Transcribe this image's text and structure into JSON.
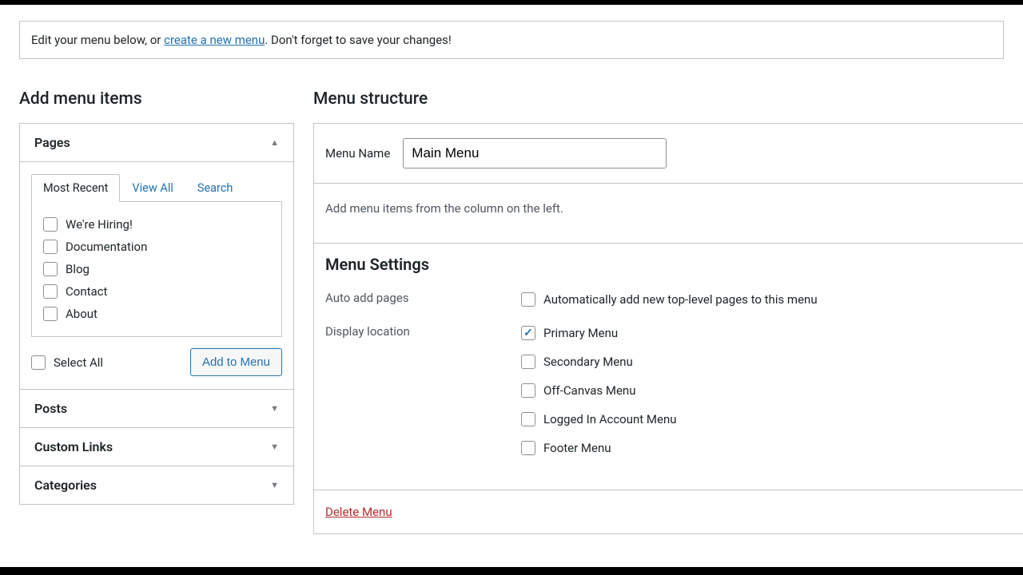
{
  "notice": {
    "prefix": "Edit your menu below, or ",
    "link": "create a new menu",
    "suffix": ". Don't forget to save your changes!"
  },
  "left": {
    "title": "Add menu items",
    "sections": {
      "pages": "Pages",
      "posts": "Posts",
      "custom_links": "Custom Links",
      "categories": "Categories"
    },
    "tabs": {
      "recent": "Most Recent",
      "view_all": "View All",
      "search": "Search"
    },
    "pages_list": [
      "We're Hiring!",
      "Documentation",
      "Blog",
      "Contact",
      "About"
    ],
    "select_all": "Select All",
    "add_btn": "Add to Menu"
  },
  "right": {
    "title": "Menu structure",
    "menu_name_label": "Menu Name",
    "menu_name_value": "Main Menu",
    "empty_hint": "Add menu items from the column on the left.",
    "settings_title": "Menu Settings",
    "auto_add_label": "Auto add pages",
    "auto_add_option": "Automatically add new top-level pages to this menu",
    "display_loc_label": "Display location",
    "locations": [
      {
        "label": "Primary Menu",
        "checked": true
      },
      {
        "label": "Secondary Menu",
        "checked": false
      },
      {
        "label": "Off-Canvas Menu",
        "checked": false
      },
      {
        "label": "Logged In Account Menu",
        "checked": false
      },
      {
        "label": "Footer Menu",
        "checked": false
      }
    ],
    "delete": "Delete Menu"
  }
}
